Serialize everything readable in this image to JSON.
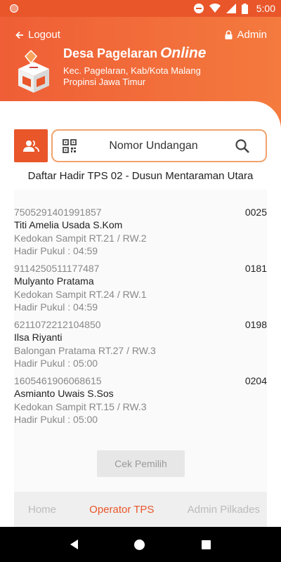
{
  "status_bar": {
    "time": "5:00"
  },
  "header": {
    "logout_label": "Logout",
    "admin_label": "Admin",
    "app_name": "Desa Pagelaran",
    "app_name_suffix": "Online",
    "subtitle_line1": "Kec. Pagelaran, Kab/Kota Malang",
    "subtitle_line2": "Propinsi Jawa Timur"
  },
  "search": {
    "placeholder": "Nomor Undangan"
  },
  "list_title": "Daftar Hadir TPS 02 - Dusun Mentaraman Utara",
  "entries": [
    {
      "nik": "7505291401991857",
      "number": "0025",
      "name": "Titi Amelia Usada S.Kom",
      "address": "Kedokan Sampit RT.21 / RW.2",
      "time": "Hadir Pukul : 04:59"
    },
    {
      "nik": "9114250511177487",
      "number": "0181",
      "name": "Mulyanto Pratama",
      "address": "Kedokan Sampit RT.24 / RW.1",
      "time": "Hadir Pukul : 04:59"
    },
    {
      "nik": "6211072212104850",
      "number": "0198",
      "name": "Ilsa Riyanti",
      "address": "Balongan Pratama RT.27 / RW.3",
      "time": "Hadir Pukul : 05:00"
    },
    {
      "nik": "1605461906068615",
      "number": "0204",
      "name": "Asmianto Uwais S.Sos",
      "address": "Kedokan Sampit RT.15 / RW.3",
      "time": "Hadir Pukul : 05:00"
    }
  ],
  "cek_button_label": "Cek Pemilih",
  "tabs": [
    {
      "label": "Home"
    },
    {
      "label": "Operator TPS"
    },
    {
      "label": "Admin Pilkades"
    }
  ],
  "colors": {
    "accent": "#e8562a",
    "header_gradient_end": "#f47a3e"
  },
  "icons": [
    "arrow-left-icon",
    "lock-icon",
    "ballot-box-logo",
    "people-icon",
    "qr-code-icon",
    "search-icon"
  ]
}
